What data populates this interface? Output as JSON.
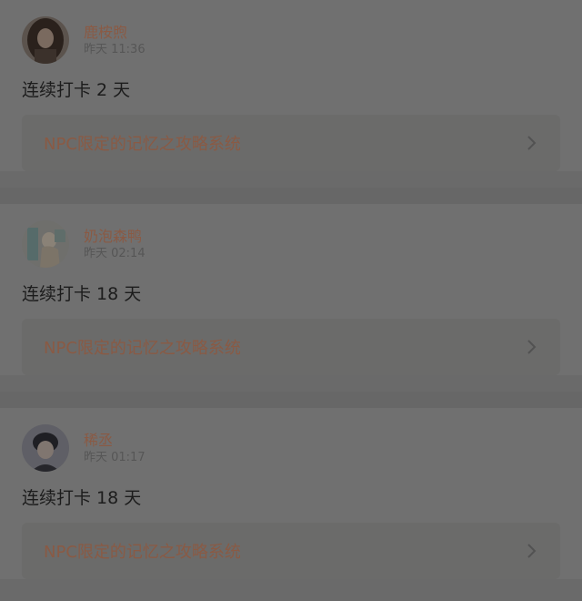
{
  "posts": [
    {
      "user_name": "鹿桉煦",
      "time": "昨天 11:36",
      "checkin_text": "连续打卡 2 天",
      "link_title": "NPC限定的记忆之攻略系统",
      "avatar_icon": "avatar-girl-dark-hair"
    },
    {
      "user_name": "奶泡森鸭",
      "time": "昨天 02:14",
      "checkin_text": "连续打卡 18 天",
      "link_title": "NPC限定的记忆之攻略系统",
      "avatar_icon": "avatar-illustration"
    },
    {
      "user_name": "稀丞",
      "time": "昨天 01:17",
      "checkin_text": "连续打卡 18 天",
      "link_title": "NPC限定的记忆之攻略系统",
      "avatar_icon": "avatar-boy"
    }
  ],
  "colors": {
    "overlay_bg": "#707070",
    "username": "#8a5a44",
    "link": "#8a5a44"
  }
}
